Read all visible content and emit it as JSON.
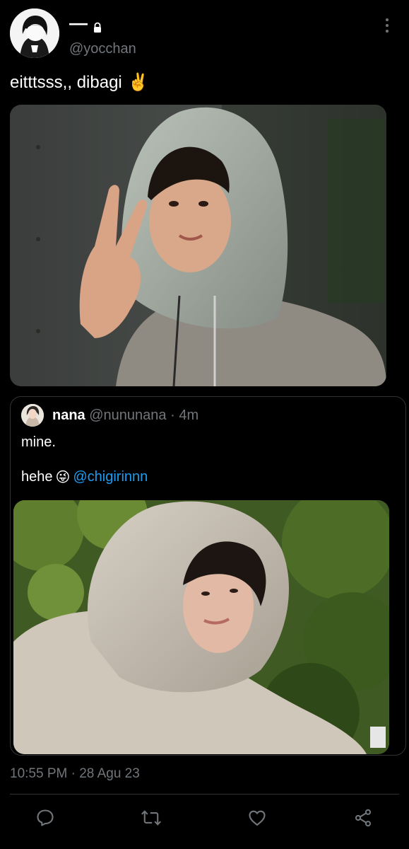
{
  "author": {
    "display_name": "—",
    "handle": "@yocchan"
  },
  "tweet": {
    "text": "eitttsss,, dibagi",
    "emoji": "✌️"
  },
  "quote": {
    "name": "nana",
    "handle": "@nununana",
    "separator": "·",
    "time": "4m",
    "line1": "mine.",
    "line2_text": "hehe",
    "line2_emoji": "😜",
    "mention": "@chigirinnn"
  },
  "meta": {
    "timestamp": "10:55 PM · 28 Agu 23"
  },
  "icons": {
    "reply": "reply-icon",
    "retweet": "retweet-icon",
    "like": "like-icon",
    "share": "share-icon",
    "more": "more-vertical-icon",
    "lock": "lock-icon"
  },
  "colors": {
    "background": "#000000",
    "text": "#ffffff",
    "secondary": "#71767b",
    "link": "#1d9bf0",
    "border": "#2f3336"
  }
}
